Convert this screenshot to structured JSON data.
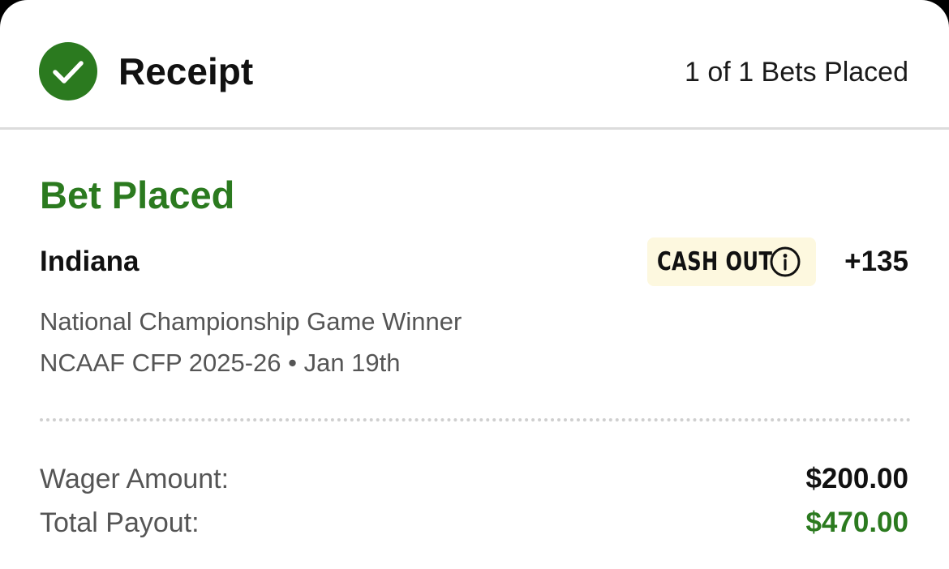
{
  "header": {
    "title": "Receipt",
    "bets_count": "1 of 1 Bets Placed",
    "icon": "check-circle-icon"
  },
  "bet": {
    "status": "Bet Placed",
    "selection": "Indiana",
    "cashout_label": "CASH OUT",
    "cashout_icon": "info-icon",
    "odds": "+135",
    "market": "National Championship Game Winner",
    "event": "NCAAF CFP 2025-26 • Jan 19th"
  },
  "summary": {
    "wager_label": "Wager Amount:",
    "wager_value": "$200.00",
    "payout_label": "Total Payout:",
    "payout_value": "$470.00"
  },
  "colors": {
    "accent_green": "#2b7a1f",
    "cashout_bg": "#fdf8df"
  }
}
